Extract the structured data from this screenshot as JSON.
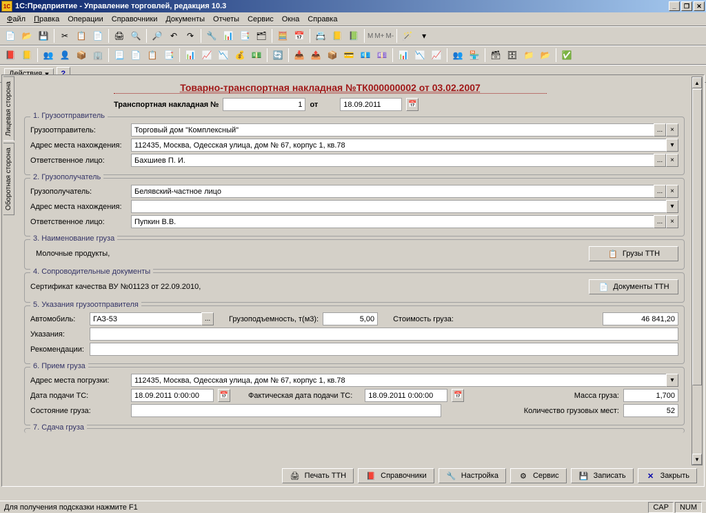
{
  "window": {
    "title": "1С:Предприятие - Управление торговлей, редакция 10.3"
  },
  "menu": {
    "file": "Файл",
    "edit": "Правка",
    "ops": "Операции",
    "refs": "Справочники",
    "docs": "Документы",
    "reports": "Отчеты",
    "service": "Сервис",
    "windows": "Окна",
    "help": "Справка"
  },
  "actions": {
    "label": "Действия"
  },
  "vtabs": {
    "front": "Лицевая сторона",
    "back": "Оборотная сторона"
  },
  "doc": {
    "title": "Товарно-транспортная накладная №ТК000000002 от 03.02.2007",
    "sub_label": "Транспортная накладная №",
    "sub_no": "1",
    "ot": "от",
    "sub_date": "18.09.2011"
  },
  "s1": {
    "legend": "1. Грузоотправитель",
    "sender_lbl": "Грузоотправитель:",
    "sender": "Торговый дом \"Комплексный\"",
    "addr_lbl": "Адрес места нахождения:",
    "addr": "112435, Москва, Одесская улица, дом № 67, корпус 1, кв.78",
    "resp_lbl": "Ответственное лицо:",
    "resp": "Бахшиев П. И."
  },
  "s2": {
    "legend": "2. Грузополучатель",
    "recv_lbl": "Грузополучатель:",
    "recv": "Белявский-частное лицо",
    "addr_lbl": "Адрес места нахождения:",
    "addr": "",
    "resp_lbl": "Ответственное лицо:",
    "resp": "Пупкин В.В."
  },
  "s3": {
    "legend": "3. Наименование груза",
    "text": "Молочные продукты,",
    "btn": "Грузы ТТН"
  },
  "s4": {
    "legend": "4. Сопроводительные документы",
    "text": "Сертификат качества ВУ №01123 от 22.09.2010,",
    "btn": "Документы ТТН"
  },
  "s5": {
    "legend": "5. Указания грузоотправителя",
    "auto_lbl": "Автомобиль:",
    "auto": "ГАЗ-53",
    "cap_lbl": "Грузоподъемность, т(м3):",
    "cap": "5,00",
    "cost_lbl": "Стоимость груза:",
    "cost": "46 841,20",
    "instr_lbl": "Указания:",
    "instr": "",
    "rec_lbl": "Рекомендации:",
    "rec": ""
  },
  "s6": {
    "legend": "6. Прием груза",
    "addr_lbl": "Адрес места погрузки:",
    "addr": "112435, Москва, Одесская улица, дом № 67, корпус 1, кв.78",
    "date1_lbl": "Дата подачи ТС:",
    "date1": "18.09.2011  0:00:00",
    "date2_lbl": "Фактическая дата подачи ТС:",
    "date2": "18.09.2011  0:00:00",
    "mass_lbl": "Масса груза:",
    "mass": "1,700",
    "state_lbl": "Состояние груза:",
    "state": "",
    "places_lbl": "Количество грузовых мест:",
    "places": "52"
  },
  "s7": {
    "legend": "7. Сдача груза"
  },
  "bottom": {
    "print": "Печать ТТН",
    "refs": "Справочники",
    "setup": "Настройка",
    "service": "Сервис",
    "save": "Записать",
    "close": "Закрыть"
  },
  "status": {
    "hint": "Для получения подсказки нажмите F1",
    "cap": "CAP",
    "num": "NUM"
  }
}
